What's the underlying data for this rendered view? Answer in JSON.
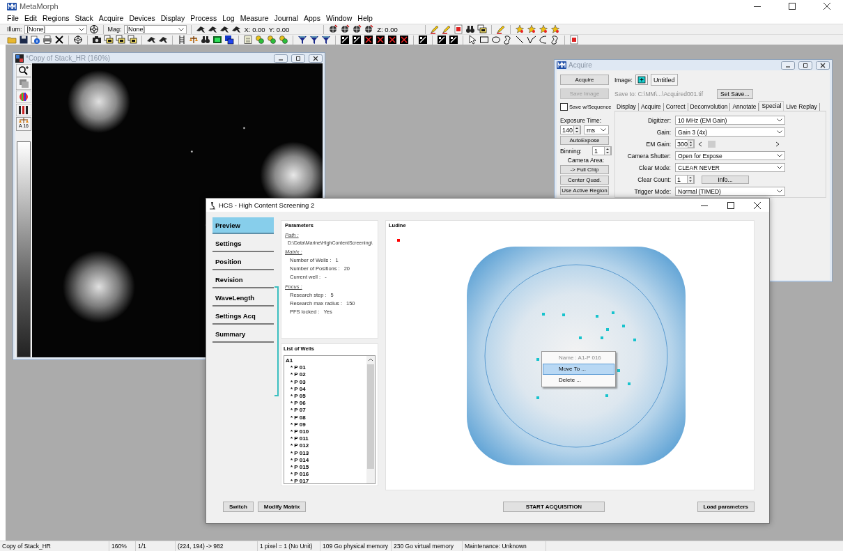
{
  "app": {
    "title": "MetaMorph"
  },
  "menu": [
    "File",
    "Edit",
    "Regions",
    "Stack",
    "Acquire",
    "Devices",
    "Display",
    "Process",
    "Log",
    "Measure",
    "Journal",
    "Apps",
    "Window",
    "Help"
  ],
  "toolbar": {
    "illum_label": "Illum:",
    "illum_value": "[None]",
    "mag_label": "Mag:",
    "mag_value": "[None]",
    "x": "X: 0.00",
    "y": "Y: 0.00",
    "z": "Z: 0.00"
  },
  "image_window": {
    "title": "*Copy of Stack_HR (160%)",
    "scale_label": "A 16"
  },
  "acquire_window": {
    "title": "Acquire",
    "acquire_button": "Acquire",
    "image_label": "Image:",
    "image_name": "Untitled",
    "save_image_button": {
      "label": "Save Image",
      "disabled": true
    },
    "save_to": "Save to: C:\\MM\\...\\Acquired001.tif",
    "set_save_button": "Set Save...",
    "save_sequence": {
      "label": "Save w/Sequence",
      "checked": false
    },
    "tabs": [
      {
        "label": "Display",
        "selected": false
      },
      {
        "label": "Acquire",
        "selected": false
      },
      {
        "label": "Correct",
        "selected": false
      },
      {
        "label": "Deconvolution",
        "selected": false
      },
      {
        "label": "Annotate",
        "selected": false
      },
      {
        "label": "Special",
        "selected": true
      },
      {
        "label": "Live Replay",
        "selected": false
      }
    ],
    "exposure_label": "Exposure Time:",
    "exposure_value": "140",
    "exposure_unit": "ms",
    "autoexpose_button": "AutoExpose",
    "binning_label": "Binning:",
    "binning_value": "1",
    "camera_area_label": "Camera Area:",
    "area_buttons": [
      "-> Full Chip",
      "Center Quad.",
      "Use Active Region"
    ],
    "settings": [
      {
        "kind": "select",
        "label": "Digitizer:",
        "value": "10 MHz (EM Gain)"
      },
      {
        "kind": "select",
        "label": "Gain:",
        "value": "Gain 3 (4x)"
      },
      {
        "kind": "spin_slider",
        "label": "EM Gain:",
        "value": "300",
        "level": 0.03
      },
      {
        "kind": "select",
        "label": "Camera Shutter:",
        "value": "Open for Expose"
      },
      {
        "kind": "select",
        "label": "Clear Mode:",
        "value": "CLEAR NEVER"
      },
      {
        "kind": "spin_button",
        "label": "Clear Count:",
        "value": "1",
        "button": "Info..."
      },
      {
        "kind": "select",
        "label": "Trigger Mode:",
        "value": "Normal (TIMED)"
      }
    ]
  },
  "hcs_window": {
    "title": "HCS - High Content Screening 2",
    "nav": [
      {
        "label": "Preview",
        "selected": true
      },
      {
        "label": "Settings",
        "selected": false
      },
      {
        "label": "Position",
        "selected": false
      },
      {
        "label": "Revision",
        "selected": false
      },
      {
        "label": "WaveLength",
        "selected": false
      },
      {
        "label": "Settings Acq",
        "selected": false
      },
      {
        "label": "Summary",
        "selected": false
      }
    ],
    "parameters": {
      "title": "Parameters",
      "sections": [
        {
          "heading": "Path :",
          "rows": [
            {
              "value": "D:\\Data\\Marine\\HighContentScreening\\"
            }
          ]
        },
        {
          "heading": "Matrix :",
          "rows": [
            {
              "label": "Number of Wells :",
              "value": "1"
            },
            {
              "label": "Number of Positions :",
              "value": "20"
            },
            {
              "label": "Current well :",
              "value": "-"
            }
          ]
        },
        {
          "heading": "Focus :",
          "rows": [
            {
              "label": "Research step :",
              "value": "5"
            },
            {
              "label": "Research max radius :",
              "value": "150"
            },
            {
              "label": "PFS locked :",
              "value": "Yes"
            }
          ]
        }
      ]
    },
    "wells": {
      "title": "List of Wells",
      "tree": [
        {
          "label": "A1",
          "children": [
            {
              "label": "* P 01"
            },
            {
              "label": "* P 02"
            },
            {
              "label": "* P 03"
            },
            {
              "label": "* P 04"
            },
            {
              "label": "* P 05"
            },
            {
              "label": "* P 06"
            },
            {
              "label": "* P 07"
            },
            {
              "label": "* P 08"
            },
            {
              "label": "* P 09"
            },
            {
              "label": "* P 010"
            },
            {
              "label": "* P 011"
            },
            {
              "label": "* P 012"
            },
            {
              "label": "* P 013"
            },
            {
              "label": "* P 014"
            },
            {
              "label": "* P 015"
            },
            {
              "label": "* P 016"
            },
            {
              "label": "* P 017"
            }
          ]
        }
      ]
    },
    "plate": {
      "title": "Ludine",
      "context_menu": [
        {
          "label": "Name : A1-P 016",
          "disabled": true,
          "selected": false
        },
        {
          "label": "Move To ...",
          "disabled": false,
          "selected": true
        },
        {
          "label": "Delete ...",
          "disabled": false,
          "selected": false
        }
      ]
    },
    "footer": {
      "left": [
        "Switch",
        "Modify Matrix"
      ],
      "center": [
        "START ACQUISITION"
      ],
      "right": [
        "Load parameters"
      ]
    }
  },
  "status_bar": [
    "Copy of Stack_HR",
    "160%",
    "1/1",
    "(224, 194) -> 982",
    "1 pixel = 1 (No Unit)",
    "109 Go physical memory",
    "230 Go virtual memory",
    "Maintenance: Unknown"
  ]
}
